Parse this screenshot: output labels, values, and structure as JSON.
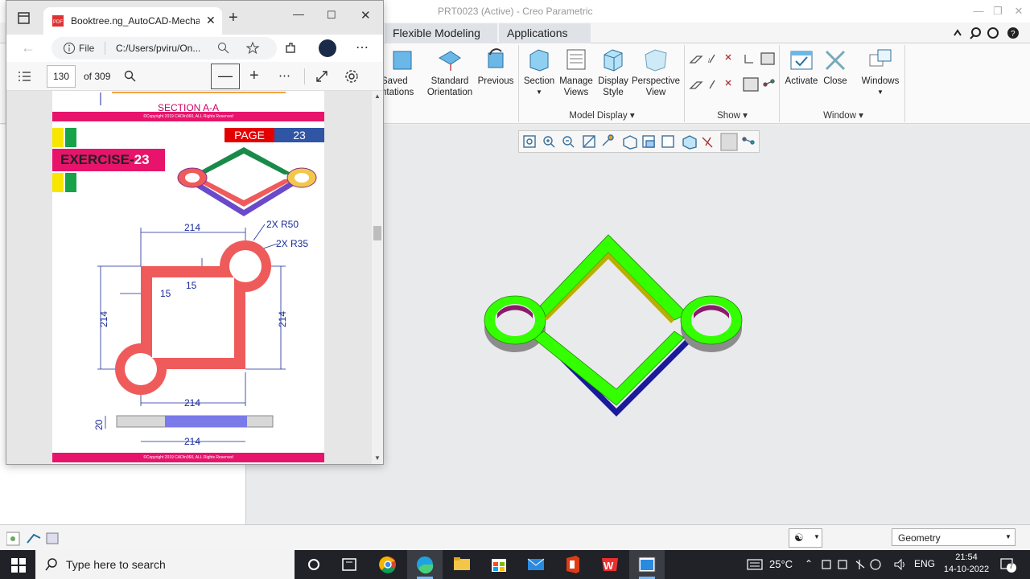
{
  "creo": {
    "title": "PRT0023 (Active) - Creo Parametric",
    "tabs": [
      "Flexible Modeling",
      "Applications"
    ],
    "ribbon": {
      "saved_orientations": "Saved\nntations",
      "standard_orientation": "Standard\nOrientation",
      "previous": "Previous",
      "section": "Section",
      "manage_views": "Manage\nViews",
      "display_style": "Display\nStyle",
      "perspective_view": "Perspective\nView",
      "activate": "Activate",
      "close": "Close",
      "windows": "Windows"
    },
    "groups": {
      "model_display": "Model Display",
      "show": "Show",
      "window": "Window"
    },
    "status": {
      "filter_value": "Geometry"
    }
  },
  "edge": {
    "tab_title": "Booktree.ng_AutoCAD-Mechanic",
    "address_file_label": "File",
    "address": "C:/Users/pviru/On...",
    "pdf": {
      "page_number": "130",
      "page_total": "of 309"
    }
  },
  "pdf_page": {
    "section_label": "SECTION A-A",
    "copyright": "©Copyright 2019 CADIn360, ALL Rights Reserved",
    "page_label": "PAGE",
    "page_number": "23",
    "exercise_label": "EXERCISE-",
    "exercise_number": "23",
    "dims": {
      "top_width": "214",
      "r50": "2X R50",
      "r35": "2X R35",
      "thickness_top": "15",
      "thickness_left": "15",
      "left_height": "214",
      "right_height": "214",
      "bottom_width": "214",
      "side_height": "20",
      "side_width": "214"
    }
  },
  "taskbar": {
    "search_placeholder": "Type here to search",
    "temperature": "25°C",
    "language": "ENG",
    "time": "21:54",
    "date": "14-10-2022",
    "notification_count": "7"
  },
  "colors": {
    "model_top": "#33ff00",
    "pdf_accent": "#e8146c",
    "pdf_blue": "#2f55a4",
    "drawing_red": "#ef5b5b",
    "dim_blue": "#1a2a9a"
  }
}
